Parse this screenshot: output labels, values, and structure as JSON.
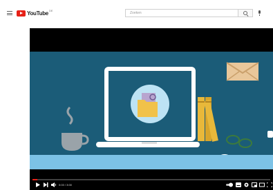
{
  "header": {
    "logo_text": "YouTube",
    "logo_country": "DE",
    "search_placeholder": "Zoeken"
  },
  "player": {
    "time": "0:03 / 3:00",
    "progress": 0.02,
    "colors": {
      "scene_bg": "#1b5c78",
      "desk": "#7cc2e6",
      "progress": "#e62117"
    }
  },
  "icons": [
    "menu-icon",
    "youtube-logo-icon",
    "search-icon",
    "mic-icon",
    "play-icon",
    "next-icon",
    "volume-icon",
    "autoplay-toggle-icon",
    "subtitles-icon",
    "settings-icon",
    "miniplayer-icon",
    "theater-icon",
    "fullscreen-icon",
    "chat-icon"
  ]
}
